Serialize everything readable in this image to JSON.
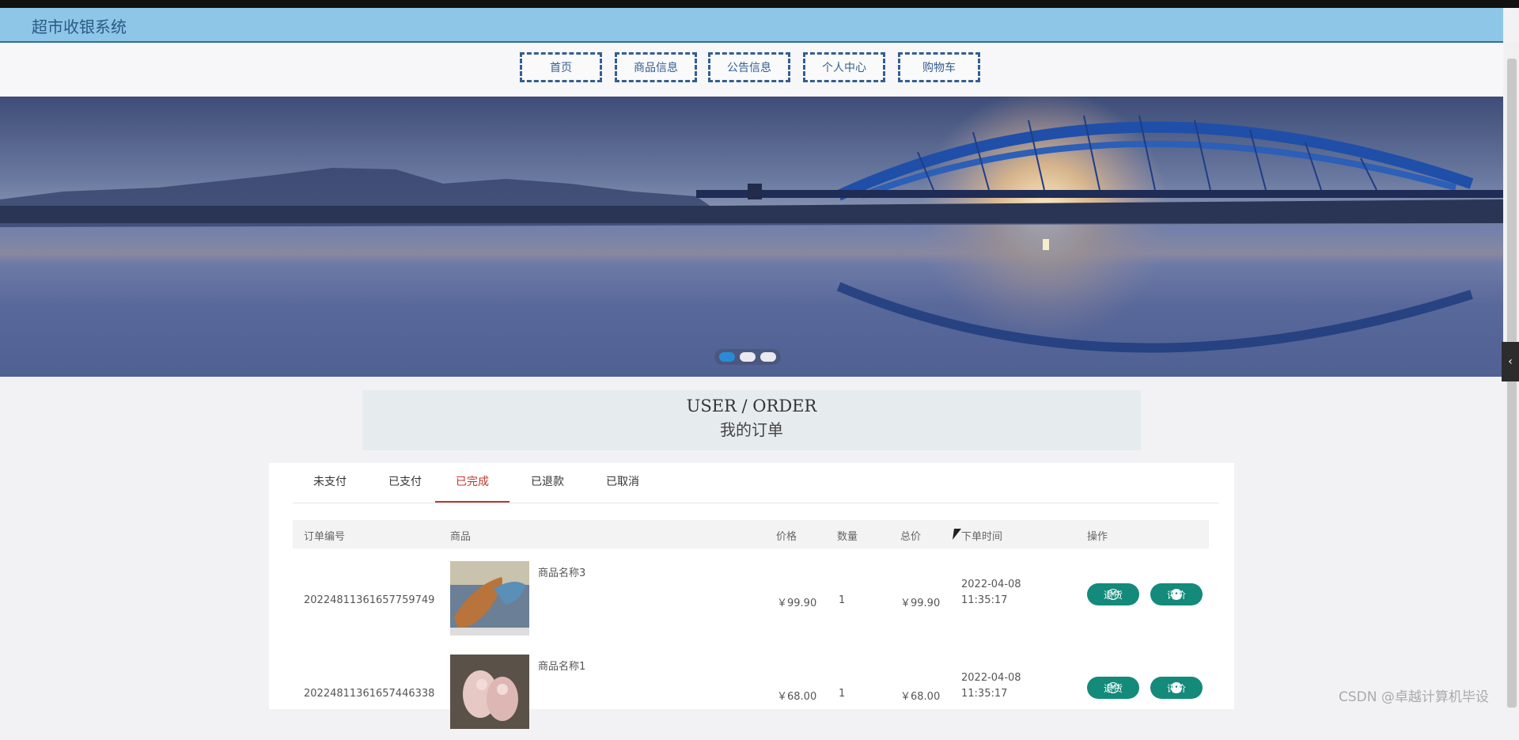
{
  "header": {
    "title": "超市收银系统"
  },
  "nav": {
    "items": [
      {
        "label": "首页"
      },
      {
        "label": "商品信息"
      },
      {
        "label": "公告信息"
      },
      {
        "label": "个人中心"
      },
      {
        "label": "购物车"
      }
    ]
  },
  "banner": {
    "dots": 3,
    "active_dot": 1
  },
  "section": {
    "title_en": "USER / ORDER",
    "title_cn": "我的订单"
  },
  "tabs": {
    "items": [
      {
        "label": "未支付"
      },
      {
        "label": "已支付"
      },
      {
        "label": "已完成"
      },
      {
        "label": "已退款"
      },
      {
        "label": "已取消"
      }
    ],
    "active": "已完成"
  },
  "table": {
    "headers": {
      "order_no": "订单编号",
      "product": "商品",
      "price": "价格",
      "qty": "数量",
      "total": "总价",
      "time": "下单时间",
      "ops": "操作"
    },
    "rows": [
      {
        "order_no": "20224811361657759749",
        "product": "商品名称3",
        "price": "￥99.90",
        "qty": "1",
        "total": "￥99.90",
        "date": "2022-04-08",
        "time": "11:35:17",
        "refund": "退货",
        "review": "评价"
      },
      {
        "order_no": "20224811361657446338",
        "product": "商品名称1",
        "price": "￥68.00",
        "qty": "1",
        "total": "￥68.00",
        "date": "2022-04-08",
        "time": "11:35:17",
        "refund": "退货",
        "review": "评价"
      }
    ]
  },
  "watermark": "CSDN @卓越计算机毕设",
  "colors": {
    "accent": "#138a7a",
    "tab_active": "#c0362c",
    "header_bg": "#8ec6e7",
    "nav_border": "#335f91"
  }
}
